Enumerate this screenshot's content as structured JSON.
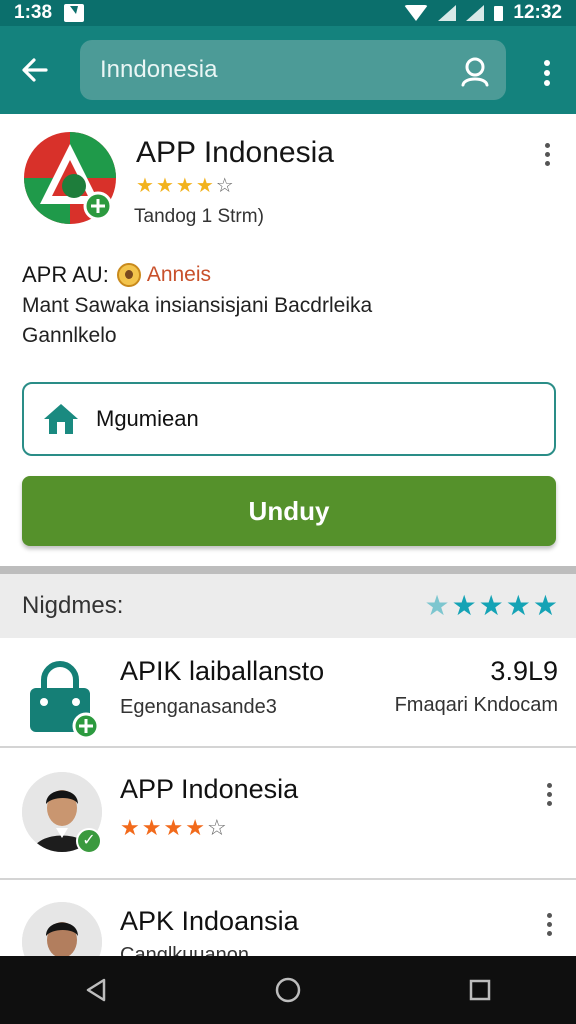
{
  "status_bar": {
    "time_left": "1:38",
    "time_right": "12:32"
  },
  "header": {
    "search_value": "Inndonesia",
    "back_icon": "arrow-left-icon",
    "search_icon": "search-icon",
    "more_icon": "more-vert-icon"
  },
  "app": {
    "title": "APP Indonesia",
    "rating_stars": 4,
    "rating_max": 5,
    "subtitle": "Tandog 1 Strm)",
    "developer_label": "APR AU:",
    "developer_name": "Anneis",
    "description_line1": "Mant Sawaka insiansisjani Bacdrleika",
    "description_line2": "Gannlkelo",
    "home_button_label": "Mgumiean",
    "download_button_label": "Unduy"
  },
  "section": {
    "title": "Nigdmes:",
    "rating_stars": 5
  },
  "list": [
    {
      "title": "APIK laiballansto",
      "subtitle": "Egenganasande3",
      "right_value": "3.9L9",
      "right_sub": "Fmaqari Kndocam"
    },
    {
      "title": "APP Indonesia",
      "rating_stars": 4,
      "rating_max": 5
    },
    {
      "title": "APK Indoansia",
      "subtitle": "Canglkuuanon"
    }
  ],
  "colors": {
    "status_bar": "#0b6f6c",
    "app_bar": "#14827d",
    "search_box": "#4c9b97",
    "primary_button": "#55912b",
    "accent_outline": "#2a8d87",
    "star_yellow": "#f2b21c",
    "star_orange": "#f26a1b",
    "star_teal": "#15a3b5",
    "nav_bar": "#0f0f0f"
  }
}
